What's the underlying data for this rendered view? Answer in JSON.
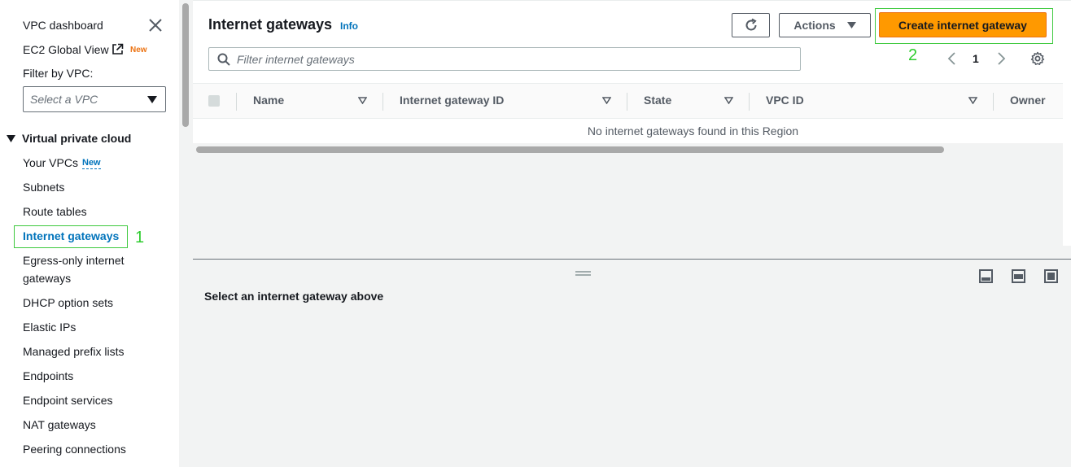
{
  "sidebar": {
    "dashboard": "VPC dashboard",
    "global_view": "EC2 Global View",
    "global_view_badge": "New",
    "filter_label": "Filter by VPC:",
    "filter_placeholder": "Select a VPC",
    "section_title": "Virtual private cloud",
    "items": [
      {
        "label": "Your VPCs",
        "badge": "New"
      },
      {
        "label": "Subnets"
      },
      {
        "label": "Route tables"
      },
      {
        "label": "Internet gateways",
        "active": true
      },
      {
        "label": "Egress-only internet"
      },
      {
        "label": "gateways"
      },
      {
        "label": "DHCP option sets"
      },
      {
        "label": "Elastic IPs"
      },
      {
        "label": "Managed prefix lists"
      },
      {
        "label": "Endpoints"
      },
      {
        "label": "Endpoint services"
      },
      {
        "label": "NAT gateways"
      },
      {
        "label": "Peering connections"
      }
    ]
  },
  "annotations": {
    "step1": "1",
    "step2": "2",
    "color": "#2ecc2e"
  },
  "header": {
    "title": "Internet gateways",
    "info": "Info",
    "actions_label": "Actions",
    "create_label": "Create internet gateway",
    "accent_color": "#ff9900"
  },
  "search": {
    "placeholder": "Filter internet gateways",
    "value": ""
  },
  "pagination": {
    "page": "1"
  },
  "table": {
    "columns": [
      "Name",
      "Internet gateway ID",
      "State",
      "VPC ID",
      "Owner"
    ],
    "empty_message": "No internet gateways found in this Region"
  },
  "split_panel": {
    "title": "Select an internet gateway above"
  },
  "icons": [
    "close-icon",
    "external-link-icon",
    "caret-down-icon",
    "refresh-icon",
    "search-icon",
    "chevron-left-icon",
    "chevron-right-icon",
    "settings-icon",
    "sort-icon",
    "drag-handle-icon",
    "panel-bottom-icon",
    "panel-side-icon",
    "panel-full-icon"
  ]
}
